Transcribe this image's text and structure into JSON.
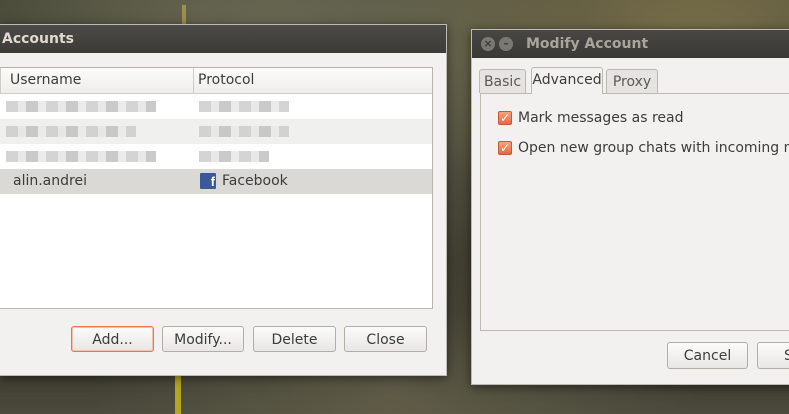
{
  "accounts_window": {
    "title": "Accounts",
    "columns": [
      "Username",
      "Protocol"
    ],
    "rows": [
      {
        "username": "alin.andrei",
        "protocol": "Facebook"
      }
    ],
    "buttons": {
      "add": "Add...",
      "modify": "Modify...",
      "delete": "Delete",
      "close": "Close"
    }
  },
  "modify_window": {
    "title": "Modify Account",
    "tabs": [
      "Basic",
      "Advanced",
      "Proxy"
    ],
    "active_tab": "Advanced",
    "options": [
      {
        "label": "Mark messages as read",
        "checked": true
      },
      {
        "label": "Open new group chats with incoming mes",
        "checked": true
      }
    ],
    "buttons": {
      "cancel": "Cancel",
      "save_partial": "S"
    }
  },
  "colors": {
    "accent": "#e46a3e",
    "facebook": "#3b5998",
    "titlebar": "#3c3b37"
  }
}
